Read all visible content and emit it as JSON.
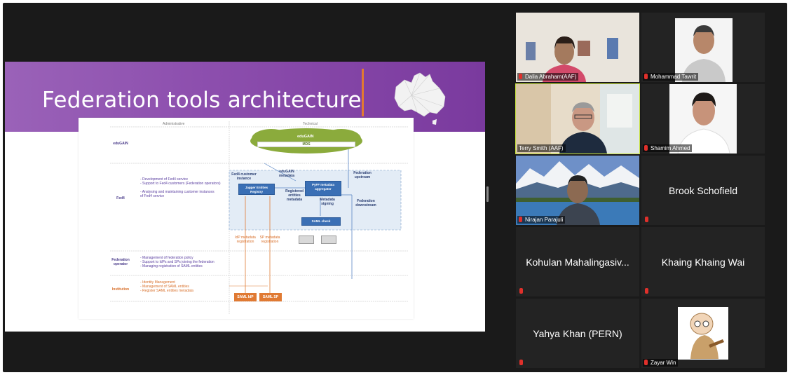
{
  "slide": {
    "title": "Federation tools architecture",
    "column_headers": [
      "Administrative",
      "Technical"
    ],
    "rows": [
      "eduGAIN",
      "Fed4",
      "Federation operator",
      "Institution"
    ],
    "cloud": {
      "label": "eduGAIN",
      "mds": "MDS"
    },
    "fed4_admin": [
      "- Development of Fed4 service",
      "- Support to Fed4 customers (Federation operators)",
      "- Analysing and maintaining customer instances",
      "  of Fed4 service"
    ],
    "operator_admin": [
      "- Management of federation policy",
      "- Support to IdPs and SPs joining the federation",
      "- Managing registration of SAML entities"
    ],
    "institution_admin": [
      "- Identity Management",
      "- Management of SAML entities",
      "- Register SAML entities metadata"
    ],
    "fed4_instance": "Fed4 customer instance",
    "jagger": "Jagger Entities Registry",
    "pyff": "PyFF metadata aggregator",
    "saml_check": "SAML check",
    "idp_md": "IdP metadata registration",
    "sp_md": "SP metadata registration",
    "edugain_md": "eduGAIN metadata",
    "registered_md": "Registered entities metadata",
    "md_signing": "Metadata signing",
    "upstream": "Federation upstream",
    "downstream": "Federation downstream",
    "saml_idp": "SAML IdP",
    "saml_sp": "SAML SP"
  },
  "participants": [
    {
      "name": "Dalia Abraham(AAF)",
      "muted": true,
      "video": true
    },
    {
      "name": "Mohammad Tawrit",
      "muted": true,
      "video": true
    },
    {
      "name": "Terry Smith (AAF)",
      "muted": false,
      "video": true,
      "active": true
    },
    {
      "name": "Shamim Ahmed",
      "muted": true,
      "video": true
    },
    {
      "name": "Nirajan Parajuli",
      "muted": true,
      "video": true
    },
    {
      "name": "Brook Schofield",
      "muted": true,
      "video": false
    },
    {
      "name": "Kohulan Mahalingasiv...",
      "muted": true,
      "video": false
    },
    {
      "name": "Khaing Khaing Wai",
      "muted": true,
      "video": false
    },
    {
      "name": "Yahya Khan (PERN)",
      "muted": true,
      "video": false
    },
    {
      "name": "Zayar Win",
      "muted": true,
      "video": true
    }
  ],
  "colors": {
    "accent_active": "#c7e23e",
    "slide_header": "#8d4fae",
    "mute": "#e0302b"
  }
}
